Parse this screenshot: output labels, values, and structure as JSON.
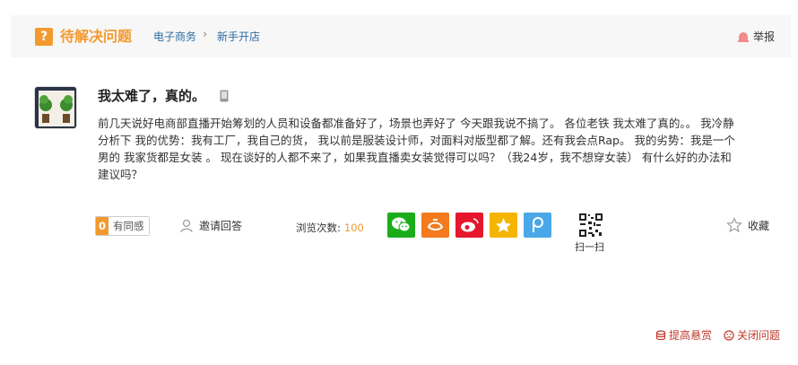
{
  "header": {
    "status_title": "待解决问题",
    "breadcrumb": [
      "电子商务",
      "新手开店"
    ],
    "separator": "›",
    "report_label": "举报"
  },
  "question": {
    "title": "我太难了，真的。",
    "body": "前几天说好电商部直播开始筹划的人员和设备都准备好了，场景也弄好了 今天跟我说不搞了。 各位老铁 我太难了真的。。 我冷静分析下 我的优势：我有工厂，我自己的货， 我以前是服装设计师，对面料对版型都了解。还有我会点Rap。 我的劣势：我是一个男的 我家货都是女装 。 现在谈好的人都不来了，如果我直播卖女装觉得可以吗？（我24岁，我不想穿女装） 有什么好的办法和建议吗？"
  },
  "actions": {
    "empathy_count": "0",
    "empathy_label": "有同感",
    "invite_label": "邀请回答",
    "views_label": "浏览次数:",
    "views_count": "100",
    "share_icons": [
      "wechat-icon",
      "alipay-icon",
      "weibo-icon",
      "qzone-icon",
      "pengyou-icon"
    ],
    "scan_label": "扫一扫",
    "collect_label": "收藏"
  },
  "footer": {
    "raise_reward": "提高悬赏",
    "close_question": "关闭问题"
  },
  "colors": {
    "accent_orange": "#f39a2f",
    "link_blue": "#2d6ca2",
    "footer_red": "#c0392b",
    "wechat_green": "#1aad19",
    "alipay_orange": "#f37b1d",
    "weibo_red": "#e6162d",
    "qzone_yellow": "#f5b400",
    "pengyou_blue": "#4aa8e8"
  }
}
